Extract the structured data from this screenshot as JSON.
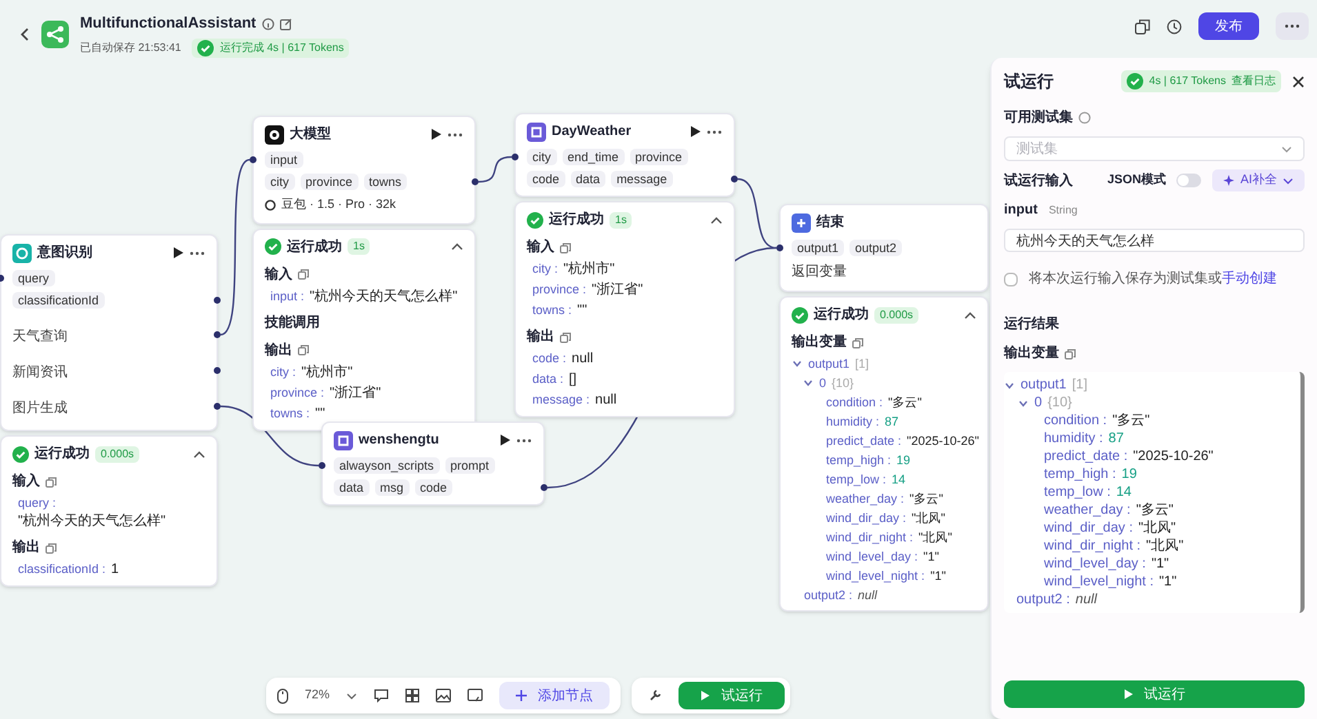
{
  "header": {
    "title": "MultifunctionalAssistant",
    "saved": "已自动保存 21:53:41",
    "run_status": "运行完成 4s | 617 Tokens",
    "publish": "发布"
  },
  "nodes": [
    {
      "kind": "intent",
      "title": "意图识别",
      "inputs": [
        "query"
      ],
      "outputs": [
        "classificationId"
      ],
      "branches": [
        "天气查询",
        "新闻资讯",
        "图片生成"
      ],
      "result": {
        "status": "运行成功",
        "time": "0.000s",
        "sections": [
          {
            "title": "输入",
            "lines": [
              {
                "key": "query :",
                "value": "\"杭州今天的天气怎么样\""
              }
            ]
          },
          {
            "title": "输出",
            "lines": [
              {
                "key": "classificationId :",
                "value": "1"
              }
            ]
          }
        ]
      }
    },
    {
      "kind": "llm",
      "title": "大模型",
      "inputs": [
        "input"
      ],
      "outputs": [
        "city",
        "province",
        "towns"
      ],
      "model": "豆包 · 1.5 · Pro · 32k",
      "result": {
        "status": "运行成功",
        "time": "1s",
        "sections": [
          {
            "title": "输入",
            "lines": [
              {
                "key": "input :",
                "value": "\"杭州今天的天气怎么样\""
              }
            ]
          },
          {
            "title": "技能调用"
          },
          {
            "title": "输出",
            "lines": [
              {
                "key": "city :",
                "value": "\"杭州市\""
              },
              {
                "key": "province :",
                "value": "\"浙江省\""
              },
              {
                "key": "towns :",
                "value": "\"\""
              }
            ]
          }
        ]
      }
    },
    {
      "kind": "plugin",
      "title": "DayWeather",
      "inputs": [
        "city",
        "end_time",
        "province"
      ],
      "outputs": [
        "code",
        "data",
        "message"
      ],
      "result": {
        "status": "运行成功",
        "time": "1s",
        "sections": [
          {
            "title": "输入",
            "lines": [
              {
                "key": "city :",
                "value": "\"杭州市\""
              },
              {
                "key": "province :",
                "value": "\"浙江省\""
              },
              {
                "key": "towns :",
                "value": "\"\""
              }
            ]
          },
          {
            "title": "输出",
            "lines": [
              {
                "key": "code :",
                "value": "null"
              },
              {
                "key": "data :",
                "value": "[]"
              },
              {
                "key": "message :",
                "value": "null"
              }
            ]
          }
        ]
      }
    },
    {
      "kind": "end",
      "title": "结束",
      "inputs": [
        "output1",
        "output2"
      ],
      "note": "返回变量",
      "result": {
        "status": "运行成功",
        "time": "0.000s",
        "sections": [
          {
            "title": "输出变量",
            "tree": [
              {
                "key": "output1",
                "summary": "[1]",
                "expanded": true,
                "children": [
                  {
                    "key": "0",
                    "summary": "{10}",
                    "expanded": true,
                    "children": [
                      {
                        "key": "condition :",
                        "value": "\"多云\"",
                        "kind": "string"
                      },
                      {
                        "key": "humidity :",
                        "value": "87",
                        "kind": "number"
                      },
                      {
                        "key": "predict_date :",
                        "value": "\"2025-10-26\"",
                        "kind": "string"
                      },
                      {
                        "key": "temp_high :",
                        "value": "19",
                        "kind": "number"
                      },
                      {
                        "key": "temp_low :",
                        "value": "14",
                        "kind": "number"
                      },
                      {
                        "key": "weather_day :",
                        "value": "\"多云\"",
                        "kind": "string"
                      },
                      {
                        "key": "wind_dir_day :",
                        "value": "\"北风\"",
                        "kind": "string"
                      },
                      {
                        "key": "wind_dir_night :",
                        "value": "\"北风\"",
                        "kind": "string"
                      },
                      {
                        "key": "wind_level_day :",
                        "value": "\"1\"",
                        "kind": "string"
                      },
                      {
                        "key": "wind_level_night :",
                        "value": "\"1\"",
                        "kind": "string"
                      }
                    ]
                  }
                ]
              },
              {
                "key": "output2 :",
                "value": "null",
                "kind": "null"
              }
            ]
          }
        ]
      }
    },
    {
      "kind": "plugin",
      "title": "wenshengtu",
      "inputs": [
        "alwayson_scripts",
        "prompt"
      ],
      "outputs": [
        "data",
        "msg",
        "code"
      ]
    }
  ],
  "panel": {
    "title": "试运行",
    "run_badge": "4s | 617 Tokens",
    "log_link": "查看日志",
    "testset_label": "可用测试集",
    "testset_placeholder": "测试集",
    "input_label": "试运行输入",
    "json_mode": {
      "label": "JSON模式",
      "on": false
    },
    "ai_button": "AI补全",
    "field": {
      "name": "input",
      "type": "String",
      "value": "杭州今天的天气怎么样"
    },
    "save_option": {
      "checked": false,
      "text": "将本次运行输入保存为测试集或",
      "link": "手动创建"
    },
    "results_label": "运行结果",
    "output_label": "输出变量",
    "tree": [
      {
        "key": "output1",
        "summary": "[1]",
        "expanded": true,
        "children": [
          {
            "key": "0",
            "summary": "{10}",
            "expanded": true,
            "children": [
              {
                "key": "condition :",
                "value": "\"多云\"",
                "kind": "string"
              },
              {
                "key": "humidity :",
                "value": "87",
                "kind": "number"
              },
              {
                "key": "predict_date :",
                "value": "\"2025-10-26\"",
                "kind": "string"
              },
              {
                "key": "temp_high :",
                "value": "19",
                "kind": "number"
              },
              {
                "key": "temp_low :",
                "value": "14",
                "kind": "number"
              },
              {
                "key": "weather_day :",
                "value": "\"多云\"",
                "kind": "string"
              },
              {
                "key": "wind_dir_day :",
                "value": "\"北风\"",
                "kind": "string"
              },
              {
                "key": "wind_dir_night :",
                "value": "\"北风\"",
                "kind": "string"
              },
              {
                "key": "wind_level_day :",
                "value": "\"1\"",
                "kind": "string"
              },
              {
                "key": "wind_level_night :",
                "value": "\"1\"",
                "kind": "string"
              }
            ]
          }
        ]
      },
      {
        "key": "output2 :",
        "value": "null",
        "kind": "null"
      }
    ],
    "run_button": "试运行"
  },
  "toolbar": {
    "zoom": "72%",
    "add_node": "添加节点",
    "run_button": "试运行"
  }
}
